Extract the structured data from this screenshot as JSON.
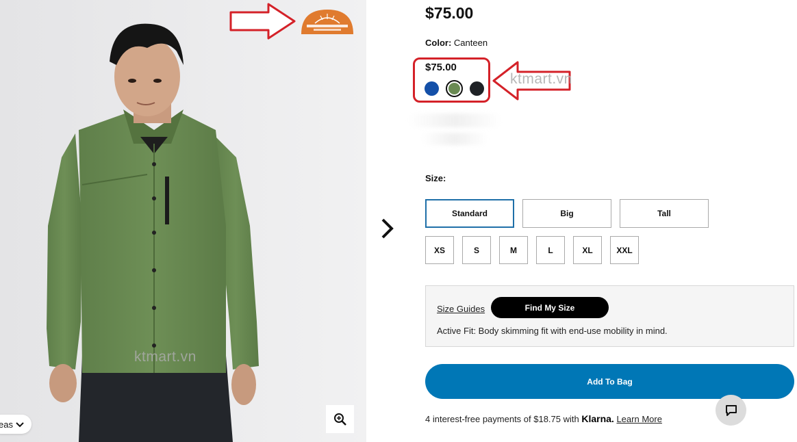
{
  "product": {
    "price": "$75.00",
    "color_label": "Color:",
    "color_value": "Canteen",
    "swatch_price": "$75.00",
    "swatches": [
      {
        "name": "blue",
        "color": "#1450a8"
      },
      {
        "name": "canteen-green",
        "color": "#6a8a53"
      },
      {
        "name": "black",
        "color": "#1f2226"
      }
    ]
  },
  "watermark": "ktmart.vn",
  "omni_shade_badge": "OMNI-SHADE SUN PROTECTION",
  "gallery": {
    "scroller_label": "eas",
    "chevron_icon": "chevron-down-icon",
    "zoom_icon": "zoom-in-icon",
    "next_icon": "chevron-right-icon"
  },
  "size": {
    "label": "Size:",
    "fits": [
      "Standard",
      "Big",
      "Tall"
    ],
    "sizes": [
      "XS",
      "S",
      "M",
      "L",
      "XL",
      "XXL"
    ]
  },
  "guide": {
    "size_guides": "Size Guides",
    "find_my_size": "Find My Size",
    "fit_description": "Active Fit: Body skimming fit with end-use mobility in mind."
  },
  "cart": {
    "add_to_bag": "Add To Bag"
  },
  "klarna": {
    "prefix": "4 interest-free payments of $18.75 with",
    "brand": "Klarna.",
    "learn_more": "Learn More"
  },
  "colors": {
    "add_bag_blue": "#0077b6",
    "annotation_red": "#d42128",
    "selected_fit_border": "#1e6fa8"
  }
}
